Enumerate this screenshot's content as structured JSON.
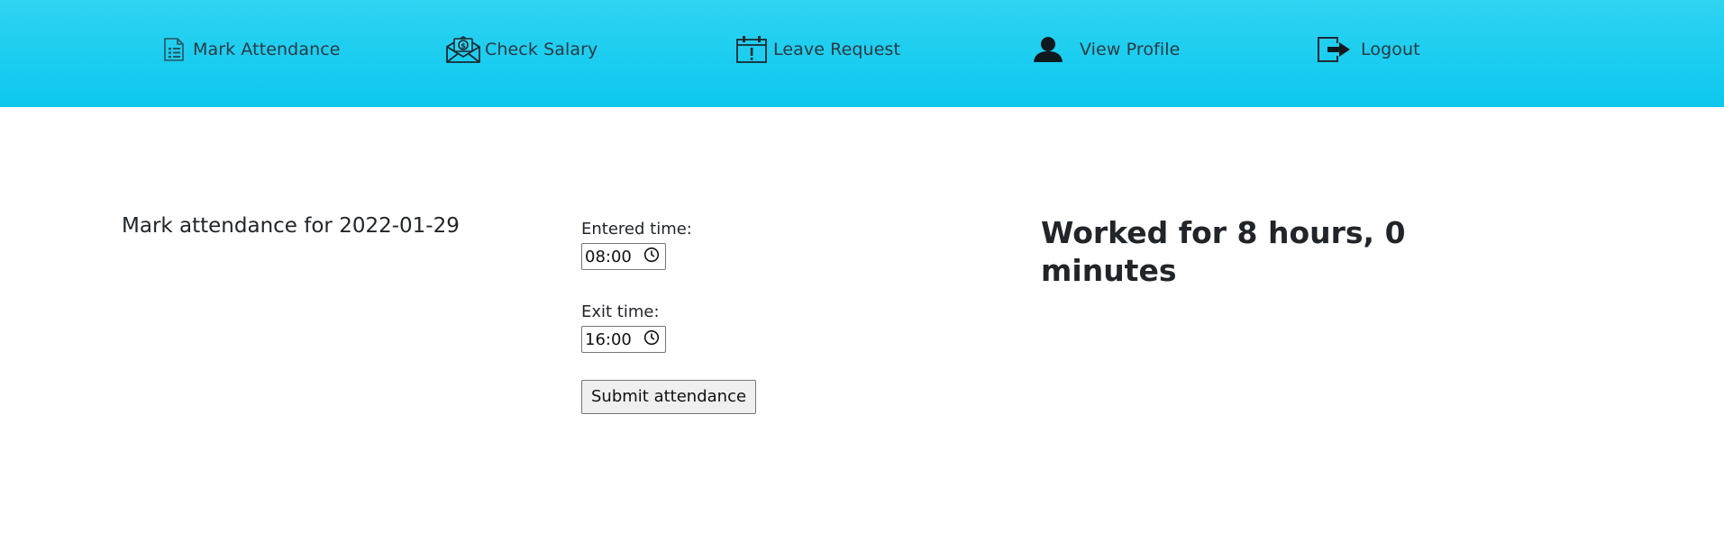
{
  "nav": {
    "mark_attendance": {
      "label": "Mark Attendance",
      "icon": "attendance-sheet-icon"
    },
    "check_salary": {
      "label": "Check Salary",
      "icon": "salary-envelope-icon"
    },
    "leave_request": {
      "label": "Leave Request",
      "icon": "calendar-alert-icon"
    },
    "view_profile": {
      "label": "View Profile",
      "icon": "user-icon"
    },
    "logout": {
      "label": "Logout",
      "icon": "logout-icon"
    }
  },
  "colors": {
    "navbar_top": "#2fd3f2",
    "navbar_bottom": "#0cc8ee"
  },
  "main": {
    "heading": "Mark attendance for 2022-01-29",
    "entered_label": "Entered time:",
    "entered_value": "08:00",
    "exit_label": "Exit time:",
    "exit_value": "16:00",
    "submit_label": "Submit attendance",
    "worked_text": "Worked for 8 hours, 0 minutes"
  }
}
